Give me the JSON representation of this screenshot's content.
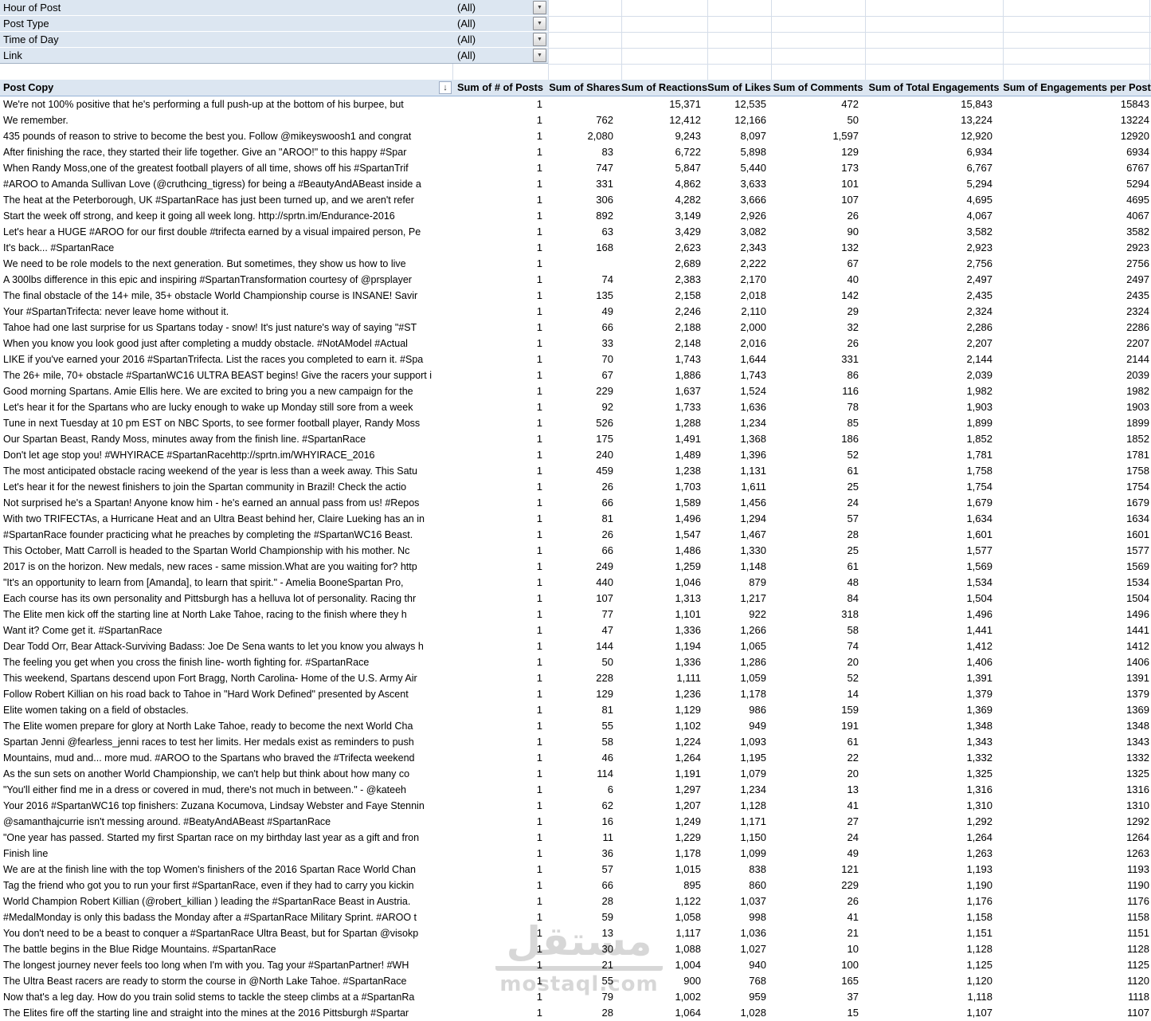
{
  "filters": [
    {
      "label": "Hour of Post",
      "value": "(All)"
    },
    {
      "label": "Post Type",
      "value": "(All)"
    },
    {
      "label": "Time of Day",
      "value": "(All)"
    },
    {
      "label": "Link",
      "value": "(All)"
    }
  ],
  "icons": {
    "dropdown": "▼",
    "sort": "↓"
  },
  "colors": {
    "pivot_blue": "#dce6f1",
    "header_border": "#95b3d7",
    "gridline": "#d5dde9",
    "watermark_gray": "#c9c9c9"
  },
  "watermark": {
    "arabic": "مستقل",
    "domain": "mostaql.com"
  },
  "table": {
    "columns": [
      "Post Copy",
      "Sum of # of Posts",
      "Sum of Shares",
      "Sum of Reactions",
      "Sum of Likes",
      "Sum of Comments",
      "Sum of Total Engagements",
      "Sum of Engagements per Post"
    ],
    "row_fields": [
      "post_copy",
      "posts",
      "shares",
      "reactions",
      "likes",
      "comments",
      "total_engagements",
      "engagements_per_post"
    ],
    "rows": [
      [
        "We're not 100% positive that he's performing a full push-up at the bottom of his burpee, but",
        "1",
        "",
        "15,371",
        "12,535",
        "472",
        "15,843",
        "15843"
      ],
      [
        "We remember.",
        "1",
        "762",
        "12,412",
        "12,166",
        "50",
        "13,224",
        "13224"
      ],
      [
        "435 pounds of reason to strive to become the best you. Follow @mikeyswoosh1 and congrat",
        "1",
        "2,080",
        "9,243",
        "8,097",
        "1,597",
        "12,920",
        "12920"
      ],
      [
        "After finishing the race, they started their life together. Give an \"AROO!\" to this happy #Spar",
        "1",
        "83",
        "6,722",
        "5,898",
        "129",
        "6,934",
        "6934"
      ],
      [
        "When Randy Moss,one of the greatest football players of all time, shows off his #SpartanTrif",
        "1",
        "747",
        "5,847",
        "5,440",
        "173",
        "6,767",
        "6767"
      ],
      [
        "#AROO to Amanda Sullivan Love (@cruthcing_tigress) for being a #BeautyAndABeast inside a",
        "1",
        "331",
        "4,862",
        "3,633",
        "101",
        "5,294",
        "5294"
      ],
      [
        "The heat at the Peterborough, UK #SpartanRace has just been turned up, and we aren't refer",
        "1",
        "306",
        "4,282",
        "3,666",
        "107",
        "4,695",
        "4695"
      ],
      [
        "Start the week off strong, and keep it going all week long. http://sprtn.im/Endurance-2016",
        "1",
        "892",
        "3,149",
        "2,926",
        "26",
        "4,067",
        "4067"
      ],
      [
        "Let's hear a HUGE #AROO for our first double #trifecta earned by a visual impaired person, Pe",
        "1",
        "63",
        "3,429",
        "3,082",
        "90",
        "3,582",
        "3582"
      ],
      [
        "It's back... #SpartanRace",
        "1",
        "168",
        "2,623",
        "2,343",
        "132",
        "2,923",
        "2923"
      ],
      [
        "We need to be role models to the next generation. But sometimes, they show us how to live",
        "1",
        "",
        "2,689",
        "2,222",
        "67",
        "2,756",
        "2756"
      ],
      [
        "A 300lbs difference in this epic and inspiring #SpartanTransformation courtesy of @prsplayer",
        "1",
        "74",
        "2,383",
        "2,170",
        "40",
        "2,497",
        "2497"
      ],
      [
        "The final obstacle of the 14+ mile, 35+ obstacle World Championship course is INSANE!  Savir",
        "1",
        "135",
        "2,158",
        "2,018",
        "142",
        "2,435",
        "2435"
      ],
      [
        "Your #SpartanTrifecta: never leave home without it.",
        "1",
        "49",
        "2,246",
        "2,110",
        "29",
        "2,324",
        "2324"
      ],
      [
        "Tahoe had one last surprise for us Spartans today - snow! It's just nature's way of saying \"#ST",
        "1",
        "66",
        "2,188",
        "2,000",
        "32",
        "2,286",
        "2286"
      ],
      [
        "When you know you look good just after completing a muddy obstacle. #NotAModel #Actual",
        "1",
        "33",
        "2,148",
        "2,016",
        "26",
        "2,207",
        "2207"
      ],
      [
        "LIKE if you've earned your 2016 #SpartanTrifecta. List the races you completed to earn it. #Spa",
        "1",
        "70",
        "1,743",
        "1,644",
        "331",
        "2,144",
        "2144"
      ],
      [
        "The 26+ mile, 70+ obstacle #SpartanWC16 ULTRA BEAST begins! Give the racers your support i",
        "1",
        "67",
        "1,886",
        "1,743",
        "86",
        "2,039",
        "2039"
      ],
      [
        "Good morning Spartans. Amie Ellis here. We are excited to bring you a new campaign for the",
        "1",
        "229",
        "1,637",
        "1,524",
        "116",
        "1,982",
        "1982"
      ],
      [
        "Let's hear it for the Spartans who are lucky enough to wake up Monday still sore from a week",
        "1",
        "92",
        "1,733",
        "1,636",
        "78",
        "1,903",
        "1903"
      ],
      [
        "Tune in next Tuesday at 10 pm EST on NBC Sports, to see former football player, Randy Moss",
        "1",
        "526",
        "1,288",
        "1,234",
        "85",
        "1,899",
        "1899"
      ],
      [
        "Our Spartan Beast, Randy Moss, minutes away from the finish line. #SpartanRace",
        "1",
        "175",
        "1,491",
        "1,368",
        "186",
        "1,852",
        "1852"
      ],
      [
        "Don't let age stop you! #WHYIRACE #SpartanRacehttp://sprtn.im/WHYIRACE_2016",
        "1",
        "240",
        "1,489",
        "1,396",
        "52",
        "1,781",
        "1781"
      ],
      [
        "The most anticipated obstacle racing weekend of the year is less than a week away. This Satu",
        "1",
        "459",
        "1,238",
        "1,131",
        "61",
        "1,758",
        "1758"
      ],
      [
        "Let's hear it for the newest finishers to join the Spartan community in Brazil! Check the actio",
        "1",
        "26",
        "1,703",
        "1,611",
        "25",
        "1,754",
        "1754"
      ],
      [
        "Not surprised he's a Spartan! Anyone know him - he's earned an annual pass from us! #Repos",
        "1",
        "66",
        "1,589",
        "1,456",
        "24",
        "1,679",
        "1679"
      ],
      [
        "With two TRIFECTAs, a Hurricane Heat and an Ultra Beast behind her, Claire Lueking has an in",
        "1",
        "81",
        "1,496",
        "1,294",
        "57",
        "1,634",
        "1634"
      ],
      [
        "#SpartanRace founder practicing what he preaches by completing the #SpartanWC16 Beast.",
        "1",
        "26",
        "1,547",
        "1,467",
        "28",
        "1,601",
        "1601"
      ],
      [
        "This October, Matt Carroll is headed to the Spartan World Championship with his mother. Nc",
        "1",
        "66",
        "1,486",
        "1,330",
        "25",
        "1,577",
        "1577"
      ],
      [
        "2017 is on the horizon. New medals, new races - same mission.What are you waiting for? http",
        "1",
        "249",
        "1,259",
        "1,148",
        "61",
        "1,569",
        "1569"
      ],
      [
        "\"It's an opportunity to learn from [Amanda], to learn that spirit.\" - Amelia BooneSpartan Pro,",
        "1",
        "440",
        "1,046",
        "879",
        "48",
        "1,534",
        "1534"
      ],
      [
        "Each course has its own personality and Pittsburgh has a helluva lot of personality. Racing thr",
        "1",
        "107",
        "1,313",
        "1,217",
        "84",
        "1,504",
        "1504"
      ],
      [
        "The Elite men kick off the starting line at North Lake Tahoe, racing to the finish where they h",
        "1",
        "77",
        "1,101",
        "922",
        "318",
        "1,496",
        "1496"
      ],
      [
        "Want it? Come get it. #SpartanRace",
        "1",
        "47",
        "1,336",
        "1,266",
        "58",
        "1,441",
        "1441"
      ],
      [
        "Dear Todd Orr, Bear Attack-Surviving Badass: Joe De Sena wants to let you know you always h",
        "1",
        "144",
        "1,194",
        "1,065",
        "74",
        "1,412",
        "1412"
      ],
      [
        "The feeling you get when you cross the finish line- worth fighting for. #SpartanRace",
        "1",
        "50",
        "1,336",
        "1,286",
        "20",
        "1,406",
        "1406"
      ],
      [
        "This weekend, Spartans descend upon Fort Bragg, North Carolina- Home of the U.S. Army Air",
        "1",
        "228",
        "1,111",
        "1,059",
        "52",
        "1,391",
        "1391"
      ],
      [
        "Follow Robert Killian on his road back to Tahoe in \"Hard Work Defined\" presented by Ascent",
        "1",
        "129",
        "1,236",
        "1,178",
        "14",
        "1,379",
        "1379"
      ],
      [
        "Elite women taking on a field of obstacles.",
        "1",
        "81",
        "1,129",
        "986",
        "159",
        "1,369",
        "1369"
      ],
      [
        "The Elite women prepare for glory at North Lake Tahoe, ready to become the next World Cha",
        "1",
        "55",
        "1,102",
        "949",
        "191",
        "1,348",
        "1348"
      ],
      [
        "Spartan Jenni @fearless_jenni races to test her limits. Her medals exist as reminders to push",
        "1",
        "58",
        "1,224",
        "1,093",
        "61",
        "1,343",
        "1343"
      ],
      [
        "Mountains, mud and... more mud. #AROO to the Spartans who braved the #Trifecta weekend",
        "1",
        "46",
        "1,264",
        "1,195",
        "22",
        "1,332",
        "1332"
      ],
      [
        "As the sun sets on another World Championship, we can't help but think about how many co",
        "1",
        "114",
        "1,191",
        "1,079",
        "20",
        "1,325",
        "1325"
      ],
      [
        "\"You'll either find me in a dress or covered in mud, there's not much in between.\" - @kateeh",
        "1",
        "6",
        "1,297",
        "1,234",
        "13",
        "1,316",
        "1316"
      ],
      [
        "Your 2016 #SpartanWC16 top finishers: Zuzana Kocumova, Lindsay Webster and Faye Stennin",
        "1",
        "62",
        "1,207",
        "1,128",
        "41",
        "1,310",
        "1310"
      ],
      [
        "@samanthajcurrie isn't messing around. #BeatyAndABeast #SpartanRace",
        "1",
        "16",
        "1,249",
        "1,171",
        "27",
        "1,292",
        "1292"
      ],
      [
        "\"One year has passed. Started my first Spartan race on my birthday last year as a gift and fron",
        "1",
        "11",
        "1,229",
        "1,150",
        "24",
        "1,264",
        "1264"
      ],
      [
        "Finish line",
        "1",
        "36",
        "1,178",
        "1,099",
        "49",
        "1,263",
        "1263"
      ],
      [
        "We are at the finish line with the top Women's finishers of the 2016 Spartan Race World Chan",
        "1",
        "57",
        "1,015",
        "838",
        "121",
        "1,193",
        "1193"
      ],
      [
        "Tag the friend who got you to run your first #SpartanRace, even if they had to carry you kickin",
        "1",
        "66",
        "895",
        "860",
        "229",
        "1,190",
        "1190"
      ],
      [
        "World Champion Robert Killian (@robert_killian ) leading the #SpartanRace Beast in Austria.",
        "1",
        "28",
        "1,122",
        "1,037",
        "26",
        "1,176",
        "1176"
      ],
      [
        "#MedalMonday is only this badass the Monday after a #SpartanRace Military Sprint. #AROO t",
        "1",
        "59",
        "1,058",
        "998",
        "41",
        "1,158",
        "1158"
      ],
      [
        "You don't need to be a beast to conquer a #SpartanRace Ultra Beast, but for Spartan  @visokp",
        "1",
        "13",
        "1,117",
        "1,036",
        "21",
        "1,151",
        "1151"
      ],
      [
        "The battle begins in the Blue Ridge Mountains. #SpartanRace",
        "1",
        "30",
        "1,088",
        "1,027",
        "10",
        "1,128",
        "1128"
      ],
      [
        "The longest journey never feels too long when I'm with you. Tag your #SpartanPartner! #WH",
        "1",
        "21",
        "1,004",
        "940",
        "100",
        "1,125",
        "1125"
      ],
      [
        "The Ultra Beast racers are ready to storm the course in @North Lake Tahoe. #SpartanRace",
        "1",
        "55",
        "900",
        "768",
        "165",
        "1,120",
        "1120"
      ],
      [
        "Now that's a leg day. How do you train solid stems to tackle the steep climbs at a #SpartanRa",
        "1",
        "79",
        "1,002",
        "959",
        "37",
        "1,118",
        "1118"
      ],
      [
        "The Elites fire off the starting line and straight into the mines at the 2016 Pittsburgh #Spartar",
        "1",
        "28",
        "1,064",
        "1,028",
        "15",
        "1,107",
        "1107"
      ]
    ]
  }
}
